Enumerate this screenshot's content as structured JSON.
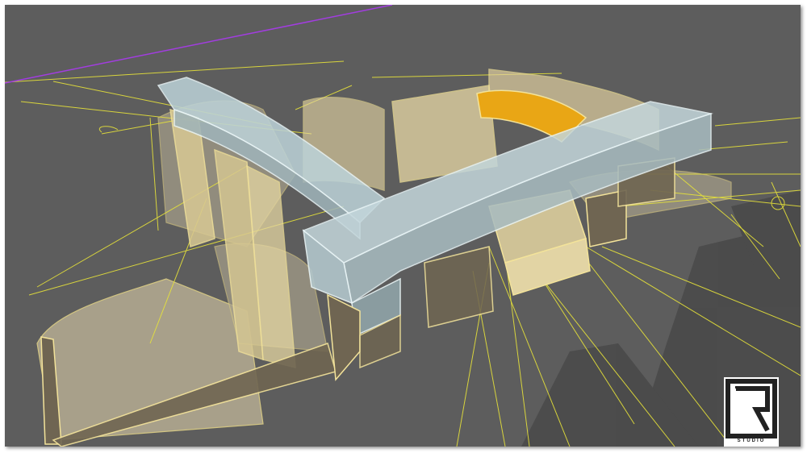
{
  "viewport": {
    "background_color": "#5d5d5d",
    "ground_shadow_color": "#4e4e4e",
    "construction_line_color": "#e6e23a",
    "axis_line_color": "#a23de0",
    "building_fill_color": "#e9d9a6",
    "building_edge_color": "#f3e39a",
    "glass_fill_color": "#bcd3d9",
    "glass_edge_color": "#e9f5f7",
    "seating_color": "#e9a615"
  },
  "logo": {
    "icon": "r-studio-logo",
    "caption": "STUDIO"
  }
}
